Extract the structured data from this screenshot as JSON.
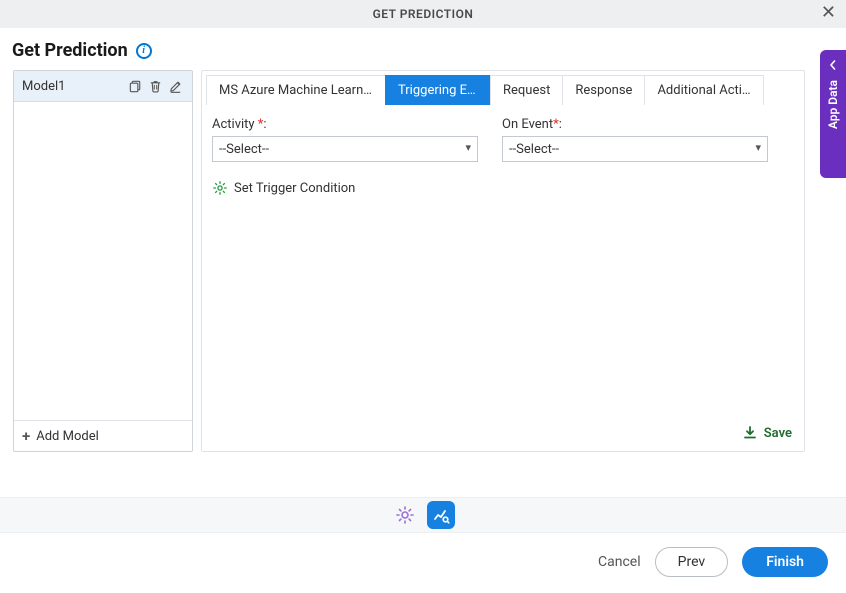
{
  "title_bar": {
    "title": "GET PREDICTION"
  },
  "header": {
    "title": "Get Prediction"
  },
  "side_tab": {
    "label": "App Data"
  },
  "left": {
    "model_name": "Model1",
    "add_model": "Add Model"
  },
  "tabs": {
    "t0": "MS Azure Machine Learning",
    "t1": "Triggering Events",
    "t2": "Request",
    "t3": "Response",
    "t4": "Additional Actions"
  },
  "form": {
    "activity_label": "Activity ",
    "onevent_label": "On Event",
    "colon": ":",
    "select_placeholder": "--Select--",
    "trigger_cond": "Set Trigger Condition",
    "save": "Save"
  },
  "footer": {
    "cancel": "Cancel",
    "prev": "Prev",
    "finish": "Finish"
  }
}
